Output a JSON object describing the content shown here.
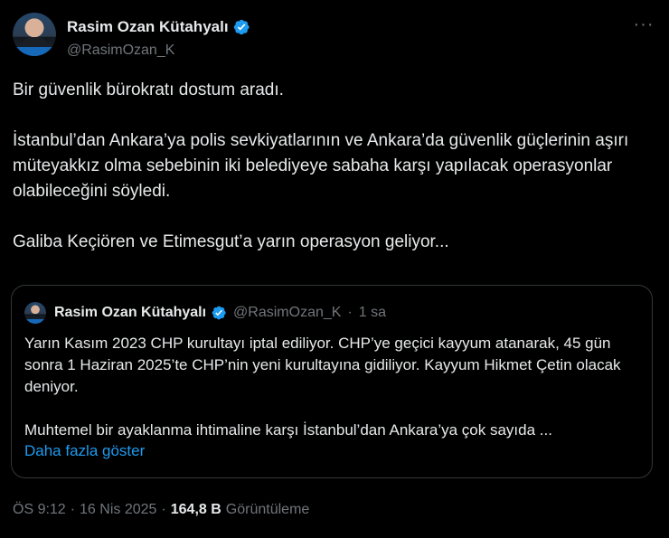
{
  "author": {
    "display_name": "Rasim Ozan Kütahyalı",
    "handle": "@RasimOzan_K"
  },
  "more_glyph": "···",
  "tweet": {
    "paragraphs": [
      "Bir güvenlik bürokratı dostum aradı.",
      "İstanbul’dan Ankara’ya polis sevkiyatlarının ve Ankara’da güvenlik güçlerinin aşırı müteyakkız olma sebebinin iki belediyeye sabaha karşı yapılacak operasyonlar olabileceğini söyledi.",
      "Galiba Keçiören ve Etimesgut’a yarın operasyon geliyor..."
    ]
  },
  "quote": {
    "display_name": "Rasim Ozan Kütahyalı",
    "handle": "@RasimOzan_K",
    "separator": "·",
    "time": "1 sa",
    "paragraphs": [
      "Yarın Kasım 2023 CHP kurultayı iptal ediliyor. CHP’ye geçici kayyum atanarak, 45 gün sonra 1 Haziran 2025’te CHP’nin yeni kurultayına gidiliyor. Kayyum Hikmet Çetin olacak deniyor.",
      "Muhtemel bir ayaklanma ihtimaline karşı İstanbul’dan Ankara’ya çok sayıda ..."
    ],
    "show_more": "Daha fazla göster"
  },
  "footer": {
    "time": "ÖS 9:12",
    "sep1": "·",
    "date": "16 Nis 2025",
    "sep2": "·",
    "views_count": "164,8 B",
    "views_label": "Görüntüleme"
  },
  "colors": {
    "background": "#000000",
    "text": "#e7e9ea",
    "muted": "#71767b",
    "link": "#1d9bf0",
    "verified": "#1d9bf0",
    "border": "#333639"
  },
  "icons": {
    "verified": "verified-badge-icon",
    "more": "more-options-icon"
  }
}
